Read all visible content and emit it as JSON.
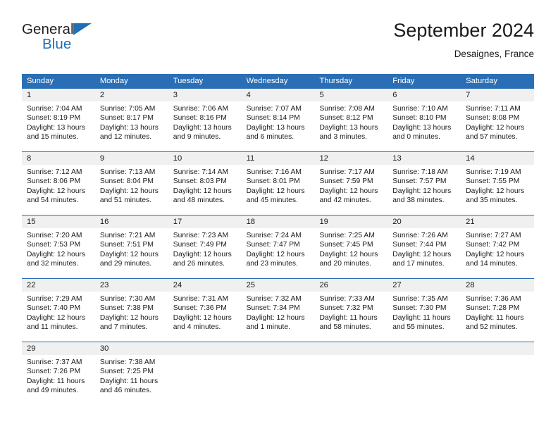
{
  "brand": {
    "name_part1": "General",
    "name_part2": "Blue"
  },
  "header": {
    "title": "September 2024",
    "subtitle": "Desaignes, France"
  },
  "colors": {
    "header_blue": "#2a6fb5",
    "daynum_band": "#f0f0f0",
    "brand_blue": "#1f6fb5",
    "text": "#1a1a1a"
  },
  "weekdays": [
    "Sunday",
    "Monday",
    "Tuesday",
    "Wednesday",
    "Thursday",
    "Friday",
    "Saturday"
  ],
  "weeks": [
    {
      "days": [
        {
          "num": "1",
          "sunrise": "Sunrise: 7:04 AM",
          "sunset": "Sunset: 8:19 PM",
          "daylight1": "Daylight: 13 hours",
          "daylight2": "and 15 minutes."
        },
        {
          "num": "2",
          "sunrise": "Sunrise: 7:05 AM",
          "sunset": "Sunset: 8:17 PM",
          "daylight1": "Daylight: 13 hours",
          "daylight2": "and 12 minutes."
        },
        {
          "num": "3",
          "sunrise": "Sunrise: 7:06 AM",
          "sunset": "Sunset: 8:16 PM",
          "daylight1": "Daylight: 13 hours",
          "daylight2": "and 9 minutes."
        },
        {
          "num": "4",
          "sunrise": "Sunrise: 7:07 AM",
          "sunset": "Sunset: 8:14 PM",
          "daylight1": "Daylight: 13 hours",
          "daylight2": "and 6 minutes."
        },
        {
          "num": "5",
          "sunrise": "Sunrise: 7:08 AM",
          "sunset": "Sunset: 8:12 PM",
          "daylight1": "Daylight: 13 hours",
          "daylight2": "and 3 minutes."
        },
        {
          "num": "6",
          "sunrise": "Sunrise: 7:10 AM",
          "sunset": "Sunset: 8:10 PM",
          "daylight1": "Daylight: 13 hours",
          "daylight2": "and 0 minutes."
        },
        {
          "num": "7",
          "sunrise": "Sunrise: 7:11 AM",
          "sunset": "Sunset: 8:08 PM",
          "daylight1": "Daylight: 12 hours",
          "daylight2": "and 57 minutes."
        }
      ]
    },
    {
      "days": [
        {
          "num": "8",
          "sunrise": "Sunrise: 7:12 AM",
          "sunset": "Sunset: 8:06 PM",
          "daylight1": "Daylight: 12 hours",
          "daylight2": "and 54 minutes."
        },
        {
          "num": "9",
          "sunrise": "Sunrise: 7:13 AM",
          "sunset": "Sunset: 8:04 PM",
          "daylight1": "Daylight: 12 hours",
          "daylight2": "and 51 minutes."
        },
        {
          "num": "10",
          "sunrise": "Sunrise: 7:14 AM",
          "sunset": "Sunset: 8:03 PM",
          "daylight1": "Daylight: 12 hours",
          "daylight2": "and 48 minutes."
        },
        {
          "num": "11",
          "sunrise": "Sunrise: 7:16 AM",
          "sunset": "Sunset: 8:01 PM",
          "daylight1": "Daylight: 12 hours",
          "daylight2": "and 45 minutes."
        },
        {
          "num": "12",
          "sunrise": "Sunrise: 7:17 AM",
          "sunset": "Sunset: 7:59 PM",
          "daylight1": "Daylight: 12 hours",
          "daylight2": "and 42 minutes."
        },
        {
          "num": "13",
          "sunrise": "Sunrise: 7:18 AM",
          "sunset": "Sunset: 7:57 PM",
          "daylight1": "Daylight: 12 hours",
          "daylight2": "and 38 minutes."
        },
        {
          "num": "14",
          "sunrise": "Sunrise: 7:19 AM",
          "sunset": "Sunset: 7:55 PM",
          "daylight1": "Daylight: 12 hours",
          "daylight2": "and 35 minutes."
        }
      ]
    },
    {
      "days": [
        {
          "num": "15",
          "sunrise": "Sunrise: 7:20 AM",
          "sunset": "Sunset: 7:53 PM",
          "daylight1": "Daylight: 12 hours",
          "daylight2": "and 32 minutes."
        },
        {
          "num": "16",
          "sunrise": "Sunrise: 7:21 AM",
          "sunset": "Sunset: 7:51 PM",
          "daylight1": "Daylight: 12 hours",
          "daylight2": "and 29 minutes."
        },
        {
          "num": "17",
          "sunrise": "Sunrise: 7:23 AM",
          "sunset": "Sunset: 7:49 PM",
          "daylight1": "Daylight: 12 hours",
          "daylight2": "and 26 minutes."
        },
        {
          "num": "18",
          "sunrise": "Sunrise: 7:24 AM",
          "sunset": "Sunset: 7:47 PM",
          "daylight1": "Daylight: 12 hours",
          "daylight2": "and 23 minutes."
        },
        {
          "num": "19",
          "sunrise": "Sunrise: 7:25 AM",
          "sunset": "Sunset: 7:45 PM",
          "daylight1": "Daylight: 12 hours",
          "daylight2": "and 20 minutes."
        },
        {
          "num": "20",
          "sunrise": "Sunrise: 7:26 AM",
          "sunset": "Sunset: 7:44 PM",
          "daylight1": "Daylight: 12 hours",
          "daylight2": "and 17 minutes."
        },
        {
          "num": "21",
          "sunrise": "Sunrise: 7:27 AM",
          "sunset": "Sunset: 7:42 PM",
          "daylight1": "Daylight: 12 hours",
          "daylight2": "and 14 minutes."
        }
      ]
    },
    {
      "days": [
        {
          "num": "22",
          "sunrise": "Sunrise: 7:29 AM",
          "sunset": "Sunset: 7:40 PM",
          "daylight1": "Daylight: 12 hours",
          "daylight2": "and 11 minutes."
        },
        {
          "num": "23",
          "sunrise": "Sunrise: 7:30 AM",
          "sunset": "Sunset: 7:38 PM",
          "daylight1": "Daylight: 12 hours",
          "daylight2": "and 7 minutes."
        },
        {
          "num": "24",
          "sunrise": "Sunrise: 7:31 AM",
          "sunset": "Sunset: 7:36 PM",
          "daylight1": "Daylight: 12 hours",
          "daylight2": "and 4 minutes."
        },
        {
          "num": "25",
          "sunrise": "Sunrise: 7:32 AM",
          "sunset": "Sunset: 7:34 PM",
          "daylight1": "Daylight: 12 hours",
          "daylight2": "and 1 minute."
        },
        {
          "num": "26",
          "sunrise": "Sunrise: 7:33 AM",
          "sunset": "Sunset: 7:32 PM",
          "daylight1": "Daylight: 11 hours",
          "daylight2": "and 58 minutes."
        },
        {
          "num": "27",
          "sunrise": "Sunrise: 7:35 AM",
          "sunset": "Sunset: 7:30 PM",
          "daylight1": "Daylight: 11 hours",
          "daylight2": "and 55 minutes."
        },
        {
          "num": "28",
          "sunrise": "Sunrise: 7:36 AM",
          "sunset": "Sunset: 7:28 PM",
          "daylight1": "Daylight: 11 hours",
          "daylight2": "and 52 minutes."
        }
      ]
    },
    {
      "days": [
        {
          "num": "29",
          "sunrise": "Sunrise: 7:37 AM",
          "sunset": "Sunset: 7:26 PM",
          "daylight1": "Daylight: 11 hours",
          "daylight2": "and 49 minutes."
        },
        {
          "num": "30",
          "sunrise": "Sunrise: 7:38 AM",
          "sunset": "Sunset: 7:25 PM",
          "daylight1": "Daylight: 11 hours",
          "daylight2": "and 46 minutes."
        },
        {
          "num": "",
          "sunrise": "",
          "sunset": "",
          "daylight1": "",
          "daylight2": ""
        },
        {
          "num": "",
          "sunrise": "",
          "sunset": "",
          "daylight1": "",
          "daylight2": ""
        },
        {
          "num": "",
          "sunrise": "",
          "sunset": "",
          "daylight1": "",
          "daylight2": ""
        },
        {
          "num": "",
          "sunrise": "",
          "sunset": "",
          "daylight1": "",
          "daylight2": ""
        },
        {
          "num": "",
          "sunrise": "",
          "sunset": "",
          "daylight1": "",
          "daylight2": ""
        }
      ]
    }
  ]
}
